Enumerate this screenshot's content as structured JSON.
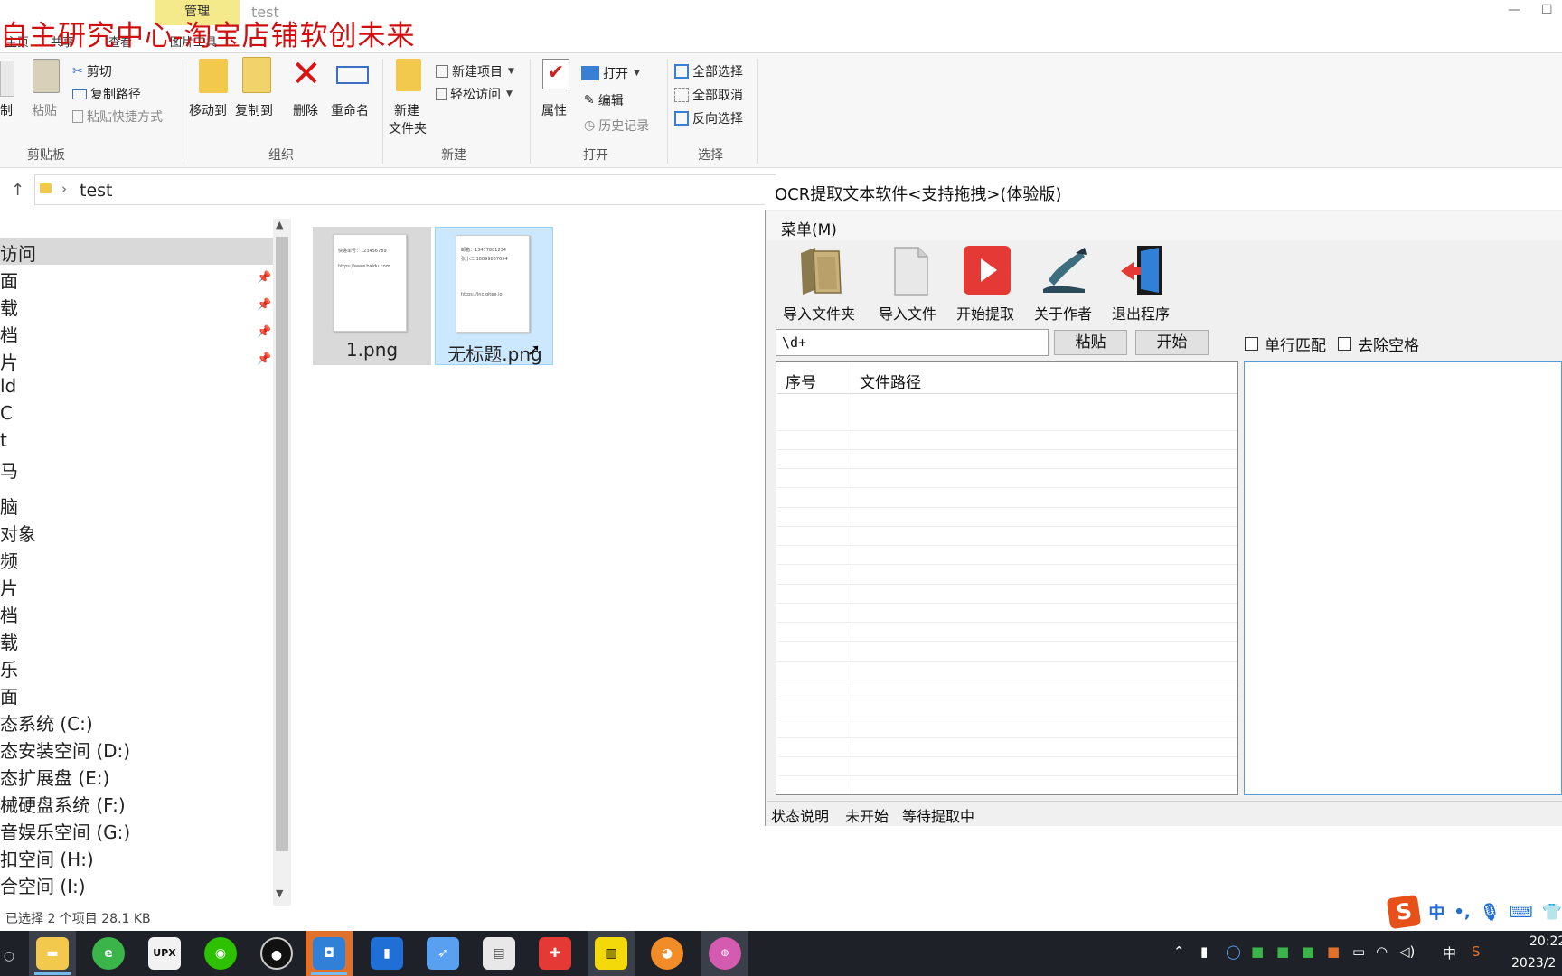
{
  "explorer": {
    "manage_tab": "管理",
    "window_title": "test",
    "watermark": "自主研究中心-淘宝店铺软创未来",
    "ribbon_tabs": [
      "主页",
      "共享",
      "查看",
      "图片工具"
    ],
    "clipboard": {
      "copy": "制",
      "paste": "粘贴",
      "cut": "剪切",
      "copy_path": "复制路径",
      "paste_shortcut": "粘贴快捷方式",
      "group": "剪贴板"
    },
    "organize": {
      "move_to": "移动到",
      "copy_to": "复制到",
      "delete": "删除",
      "rename": "重命名",
      "group": "组织"
    },
    "new": {
      "new_folder_1": "新建",
      "new_folder_2": "文件夹",
      "new_item": "新建项目",
      "easy_access": "轻松访问",
      "group": "新建"
    },
    "open": {
      "properties": "属性",
      "open": "打开",
      "edit": "编辑",
      "history": "历史记录",
      "group": "打开"
    },
    "select": {
      "select_all": "全部选择",
      "select_none": "全部取消",
      "invert": "反向选择",
      "group": "选择"
    },
    "address": {
      "path": "test"
    },
    "nav": {
      "quick_access": "访问",
      "items": [
        "面",
        "载",
        "档",
        "片",
        "ld",
        "C",
        "t",
        "马",
        "脑",
        "对象",
        "频",
        "片",
        "档",
        "载",
        "乐",
        "面",
        "态系统 (C:)",
        "态安装空间 (D:)",
        "态扩展盘 (E:)",
        "械硬盘系统 (F:)",
        "音娱乐空间 (G:)",
        "扣空间 (H:)",
        "合空间 (I:)"
      ]
    },
    "files": [
      {
        "name": "1.png",
        "lines": [
          "快递单号：123456789",
          "https://www.baidu.com"
        ]
      },
      {
        "name": "无标题.png",
        "lines": [
          "邮箱：13477881234",
          "张小二 18899887654",
          "https://lnc.gitee.io"
        ]
      }
    ],
    "status": "已选择 2 个项目  28.1 KB"
  },
  "ocr": {
    "title": "OCR提取文本软件<支持拖拽>(体验版)",
    "menu": "菜单(M)",
    "tools": [
      "导入文件夹",
      "导入文件",
      "开始提取",
      "关于作者",
      "退出程序"
    ],
    "regex_value": "\\d+",
    "paste_btn": "粘贴",
    "start_btn": "开始",
    "single_line": "单行匹配",
    "remove_space": "去除空格",
    "col_index": "序号",
    "col_path": "文件路径",
    "status_label": "状态说明",
    "status_state": "未开始",
    "status_wait": "等待提取中"
  },
  "ime": {
    "lang": "中",
    "punct": "•,",
    "icons": [
      "mic-icon",
      "keyboard-icon",
      "shirt-icon"
    ]
  },
  "taskbar": {
    "upx": "UPX",
    "tray_lang": "中",
    "time": "20:22",
    "date": "2023/2"
  },
  "colors": {
    "watermark": "#d01010",
    "selected_file": "#cce8ff",
    "taskbar": "#1e2128",
    "play": "#e53935"
  }
}
